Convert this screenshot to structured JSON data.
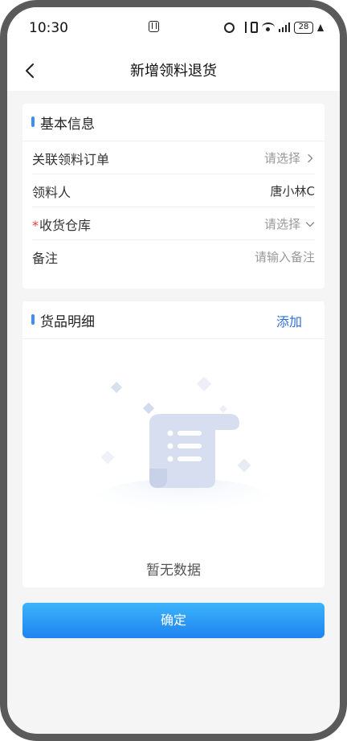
{
  "status_bar": {
    "time": "10:30",
    "battery": "28"
  },
  "header": {
    "title": "新增领料退货"
  },
  "basic_info": {
    "title": "基本信息",
    "rows": [
      {
        "label": "关联领料订单",
        "value": "请选择",
        "required": false,
        "kind": "select-arrow"
      },
      {
        "label": "领料人",
        "value": "唐小林C",
        "required": false,
        "kind": "text"
      },
      {
        "label": "收货仓库",
        "value": "请选择",
        "required": true,
        "required_mark": "*",
        "kind": "select-down"
      },
      {
        "label": "备注",
        "value": "请输入备注",
        "required": false,
        "kind": "input"
      }
    ]
  },
  "goods_detail": {
    "title": "货品明细",
    "add_label": "添加",
    "empty_text": "暂无数据"
  },
  "footer": {
    "confirm_label": "确定"
  },
  "colors": {
    "accent": "#3d8ef7",
    "link": "#2f6fd6",
    "required": "#e8383d",
    "button_top": "#3cb4fb",
    "button_bottom": "#1f83f0",
    "page_bg": "#f5f5f5"
  },
  "icons": {
    "back": "chevron-left-icon",
    "select_arrow": "chevron-right-icon",
    "select_down": "chevron-down-icon",
    "empty": "empty-document-illustration"
  }
}
